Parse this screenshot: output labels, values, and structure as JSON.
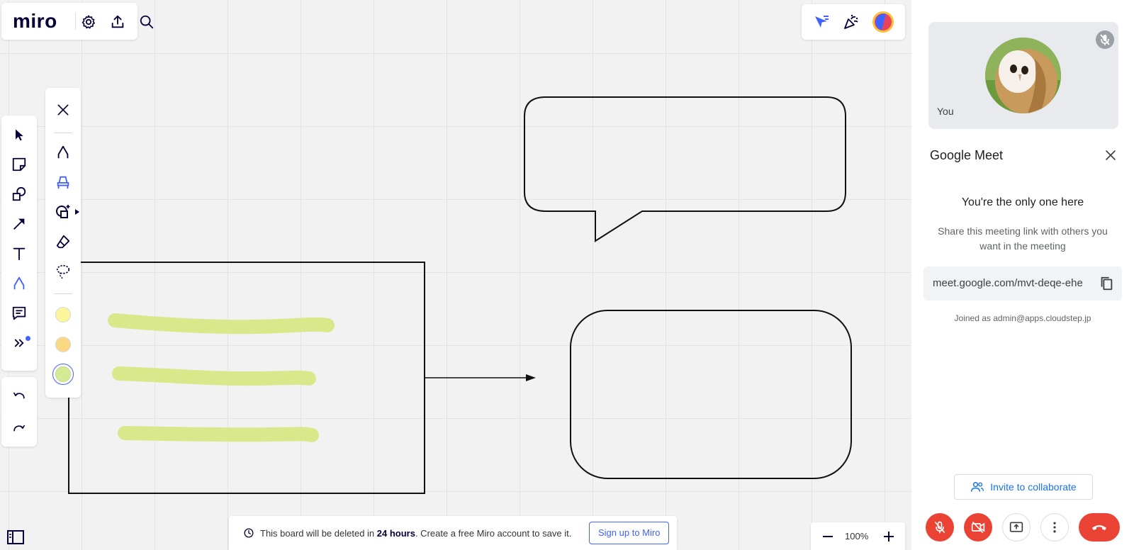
{
  "app": {
    "logo": "miro"
  },
  "toolbar_left": {
    "tools": [
      "select",
      "sticky-note",
      "shapes",
      "connection-line",
      "text",
      "pen",
      "comment",
      "more-tools"
    ],
    "undo": "undo",
    "redo": "redo"
  },
  "pen_panel": {
    "swatches": [
      "#fdf59a",
      "#fbd983",
      "#d5ea96"
    ],
    "selected_swatch": 2
  },
  "notice": {
    "text_before": "This board will be deleted in ",
    "text_bold": "24 hours",
    "text_after": ". Create a free Miro account to save it.",
    "signup_label": "Sign up to Miro"
  },
  "zoom": {
    "value": "100%"
  },
  "meet": {
    "you_label": "You",
    "title": "Google Meet",
    "only_one": "You're the only one here",
    "share_text": "Share this meeting link with others you want in the meeting",
    "link": "meet.google.com/mvt-deqe-ehe",
    "joined_as": "Joined as admin@apps.cloudstep.jp",
    "invite_label": "Invite to collaborate"
  },
  "colors": {
    "brand_blue": "#4262ff",
    "meet_red": "#ea4335",
    "highlighter": "#d9e88a"
  }
}
